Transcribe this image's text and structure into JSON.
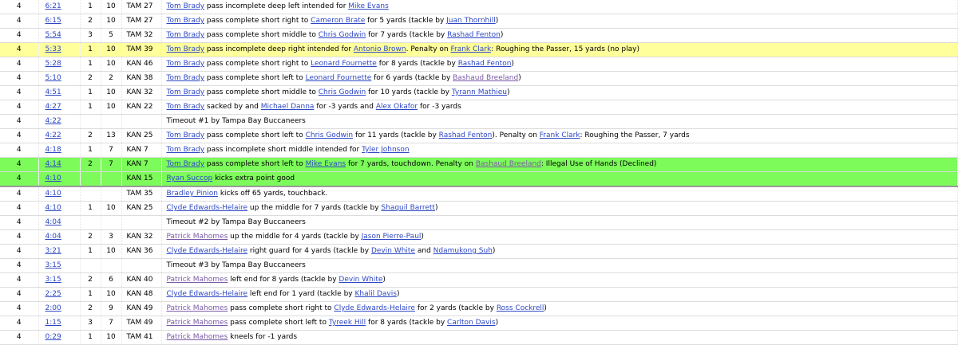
{
  "colors": {
    "link": "#2e48c5",
    "visited_link": "#7b5aa6",
    "highlight_penalty": "#ffff9b",
    "highlight_score": "#7cfb5a"
  },
  "rows": [
    {
      "quarter": "4",
      "time": "6:21",
      "down": "1",
      "togo": "10",
      "location": "TAM 27",
      "style": "plain",
      "detail": [
        {
          "t": "link",
          "v": "Tom Brady"
        },
        {
          "t": "text",
          "v": " pass incomplete deep left intended for "
        },
        {
          "t": "link",
          "v": "Mike Evans"
        }
      ]
    },
    {
      "quarter": "4",
      "time": "6:15",
      "down": "2",
      "togo": "10",
      "location": "TAM 27",
      "style": "plain",
      "detail": [
        {
          "t": "link",
          "v": "Tom Brady"
        },
        {
          "t": "text",
          "v": " pass complete short right to "
        },
        {
          "t": "link",
          "v": "Cameron Brate"
        },
        {
          "t": "text",
          "v": " for 5 yards (tackle by "
        },
        {
          "t": "link",
          "v": "Juan Thornhill"
        },
        {
          "t": "text",
          "v": ")"
        }
      ]
    },
    {
      "quarter": "4",
      "time": "5:54",
      "down": "3",
      "togo": "5",
      "location": "TAM 32",
      "style": "plain",
      "detail": [
        {
          "t": "link",
          "v": "Tom Brady"
        },
        {
          "t": "text",
          "v": " pass complete short middle to "
        },
        {
          "t": "link",
          "v": "Chris Godwin"
        },
        {
          "t": "text",
          "v": " for 7 yards (tackle by "
        },
        {
          "t": "link",
          "v": "Rashad Fenton"
        },
        {
          "t": "text",
          "v": ")"
        }
      ]
    },
    {
      "quarter": "4",
      "time": "5:33",
      "down": "1",
      "togo": "10",
      "location": "TAM 39",
      "style": "yellow",
      "detail": [
        {
          "t": "link",
          "v": "Tom Brady"
        },
        {
          "t": "text",
          "v": " pass incomplete deep right intended for "
        },
        {
          "t": "link",
          "v": "Antonio Brown"
        },
        {
          "t": "text",
          "v": ". Penalty on "
        },
        {
          "t": "link",
          "v": "Frank Clark"
        },
        {
          "t": "text",
          "v": ": Roughing the Passer, 15 yards (no play)"
        }
      ]
    },
    {
      "quarter": "4",
      "time": "5:28",
      "down": "1",
      "togo": "10",
      "location": "KAN 46",
      "style": "plain",
      "detail": [
        {
          "t": "link",
          "v": "Tom Brady"
        },
        {
          "t": "text",
          "v": " pass complete short right to "
        },
        {
          "t": "link",
          "v": "Leonard Fournette"
        },
        {
          "t": "text",
          "v": " for 8 yards (tackle by "
        },
        {
          "t": "link",
          "v": "Rashad Fenton"
        },
        {
          "t": "text",
          "v": ")"
        }
      ]
    },
    {
      "quarter": "4",
      "time": "5:10",
      "down": "2",
      "togo": "2",
      "location": "KAN 38",
      "style": "plain",
      "detail": [
        {
          "t": "link",
          "v": "Tom Brady"
        },
        {
          "t": "text",
          "v": " pass complete short left to "
        },
        {
          "t": "link",
          "v": "Leonard Fournette"
        },
        {
          "t": "text",
          "v": " for 6 yards (tackle by "
        },
        {
          "t": "vlink",
          "v": "Bashaud Breeland"
        },
        {
          "t": "text",
          "v": ")"
        }
      ]
    },
    {
      "quarter": "4",
      "time": "4:51",
      "down": "1",
      "togo": "10",
      "location": "KAN 32",
      "style": "plain",
      "detail": [
        {
          "t": "link",
          "v": "Tom Brady"
        },
        {
          "t": "text",
          "v": " pass complete short middle to "
        },
        {
          "t": "link",
          "v": "Chris Godwin"
        },
        {
          "t": "text",
          "v": " for 10 yards (tackle by "
        },
        {
          "t": "link",
          "v": "Tyrann Mathieu"
        },
        {
          "t": "text",
          "v": ")"
        }
      ]
    },
    {
      "quarter": "4",
      "time": "4:27",
      "down": "1",
      "togo": "10",
      "location": "KAN 22",
      "style": "plain",
      "detail": [
        {
          "t": "link",
          "v": "Tom Brady"
        },
        {
          "t": "text",
          "v": " sacked by and "
        },
        {
          "t": "link",
          "v": "Michael Danna"
        },
        {
          "t": "text",
          "v": " for -3 yards and "
        },
        {
          "t": "link",
          "v": "Alex Okafor"
        },
        {
          "t": "text",
          "v": " for -3 yards"
        }
      ]
    },
    {
      "quarter": "4",
      "time": "4:22",
      "down": "",
      "togo": "",
      "location": "",
      "style": "plain",
      "detail": [
        {
          "t": "text",
          "v": "Timeout #1 by Tampa Bay Buccaneers"
        }
      ]
    },
    {
      "quarter": "4",
      "time": "4:22",
      "down": "2",
      "togo": "13",
      "location": "KAN 25",
      "style": "plain",
      "detail": [
        {
          "t": "link",
          "v": "Tom Brady"
        },
        {
          "t": "text",
          "v": " pass complete short left to "
        },
        {
          "t": "link",
          "v": "Chris Godwin"
        },
        {
          "t": "text",
          "v": " for 11 yards (tackle by "
        },
        {
          "t": "link",
          "v": "Rashad Fenton"
        },
        {
          "t": "text",
          "v": "). Penalty on "
        },
        {
          "t": "link",
          "v": "Frank Clark"
        },
        {
          "t": "text",
          "v": ": Roughing the Passer, 7 yards"
        }
      ]
    },
    {
      "quarter": "4",
      "time": "4:18",
      "down": "1",
      "togo": "7",
      "location": "KAN 7",
      "style": "plain",
      "detail": [
        {
          "t": "link",
          "v": "Tom Brady"
        },
        {
          "t": "text",
          "v": " pass incomplete short middle intended for "
        },
        {
          "t": "link",
          "v": "Tyler Johnson"
        }
      ]
    },
    {
      "quarter": "4",
      "time": "4:14",
      "down": "2",
      "togo": "7",
      "location": "KAN 7",
      "style": "green",
      "detail": [
        {
          "t": "link",
          "v": "Tom Brady"
        },
        {
          "t": "text",
          "v": " pass complete short left to "
        },
        {
          "t": "link",
          "v": "Mike Evans"
        },
        {
          "t": "text",
          "v": " for 7 yards, touchdown. Penalty on "
        },
        {
          "t": "vlink",
          "v": "Bashaud Breeland"
        },
        {
          "t": "text",
          "v": ": Illegal Use of Hands (Declined)"
        }
      ]
    },
    {
      "quarter": "4",
      "time": "4:10",
      "down": "",
      "togo": "",
      "location": "KAN 15",
      "style": "green",
      "divider": true,
      "detail": [
        {
          "t": "link",
          "v": "Ryan Succop"
        },
        {
          "t": "text",
          "v": " kicks extra point good"
        }
      ]
    },
    {
      "quarter": "4",
      "time": "4:10",
      "down": "",
      "togo": "",
      "location": "TAM 35",
      "style": "plain",
      "detail": [
        {
          "t": "link",
          "v": "Bradley Pinion"
        },
        {
          "t": "text",
          "v": " kicks off 65 yards, touchback."
        }
      ]
    },
    {
      "quarter": "4",
      "time": "4:10",
      "down": "1",
      "togo": "10",
      "location": "KAN 25",
      "style": "plain",
      "detail": [
        {
          "t": "link",
          "v": "Clyde Edwards-Helaire"
        },
        {
          "t": "text",
          "v": " up the middle for 7 yards (tackle by "
        },
        {
          "t": "link",
          "v": "Shaquil Barrett"
        },
        {
          "t": "text",
          "v": ")"
        }
      ]
    },
    {
      "quarter": "4",
      "time": "4:04",
      "down": "",
      "togo": "",
      "location": "",
      "style": "plain",
      "detail": [
        {
          "t": "text",
          "v": "Timeout #2 by Tampa Bay Buccaneers"
        }
      ]
    },
    {
      "quarter": "4",
      "time": "4:04",
      "down": "2",
      "togo": "3",
      "location": "KAN 32",
      "style": "plain",
      "detail": [
        {
          "t": "vlink",
          "v": "Patrick Mahomes"
        },
        {
          "t": "text",
          "v": " up the middle for 4 yards (tackle by "
        },
        {
          "t": "link",
          "v": "Jason Pierre-Paul"
        },
        {
          "t": "text",
          "v": ")"
        }
      ]
    },
    {
      "quarter": "4",
      "time": "3:21",
      "down": "1",
      "togo": "10",
      "location": "KAN 36",
      "style": "plain",
      "detail": [
        {
          "t": "link",
          "v": "Clyde Edwards-Helaire"
        },
        {
          "t": "text",
          "v": " right guard for 4 yards (tackle by "
        },
        {
          "t": "link",
          "v": "Devin White"
        },
        {
          "t": "text",
          "v": " and "
        },
        {
          "t": "link",
          "v": "Ndamukong Suh"
        },
        {
          "t": "text",
          "v": ")"
        }
      ]
    },
    {
      "quarter": "4",
      "time": "3:15",
      "down": "",
      "togo": "",
      "location": "",
      "style": "plain",
      "detail": [
        {
          "t": "text",
          "v": "Timeout #3 by Tampa Bay Buccaneers"
        }
      ]
    },
    {
      "quarter": "4",
      "time": "3:15",
      "down": "2",
      "togo": "6",
      "location": "KAN 40",
      "style": "plain",
      "detail": [
        {
          "t": "vlink",
          "v": "Patrick Mahomes"
        },
        {
          "t": "text",
          "v": " left end for 8 yards (tackle by "
        },
        {
          "t": "link",
          "v": "Devin White"
        },
        {
          "t": "text",
          "v": ")"
        }
      ]
    },
    {
      "quarter": "4",
      "time": "2:25",
      "down": "1",
      "togo": "10",
      "location": "KAN 48",
      "style": "plain",
      "detail": [
        {
          "t": "link",
          "v": "Clyde Edwards-Helaire"
        },
        {
          "t": "text",
          "v": " left end for 1 yard (tackle by "
        },
        {
          "t": "link",
          "v": "Khalil Davis"
        },
        {
          "t": "text",
          "v": ")"
        }
      ]
    },
    {
      "quarter": "4",
      "time": "2:00",
      "down": "2",
      "togo": "9",
      "location": "KAN 49",
      "style": "plain",
      "detail": [
        {
          "t": "vlink",
          "v": "Patrick Mahomes"
        },
        {
          "t": "text",
          "v": " pass complete short right to "
        },
        {
          "t": "link",
          "v": "Clyde Edwards-Helaire"
        },
        {
          "t": "text",
          "v": " for 2 yards (tackle by "
        },
        {
          "t": "link",
          "v": "Ross Cockrell"
        },
        {
          "t": "text",
          "v": ")"
        }
      ]
    },
    {
      "quarter": "4",
      "time": "1:15",
      "down": "3",
      "togo": "7",
      "location": "TAM 49",
      "style": "plain",
      "detail": [
        {
          "t": "vlink",
          "v": "Patrick Mahomes"
        },
        {
          "t": "text",
          "v": " pass complete short left to "
        },
        {
          "t": "link",
          "v": "Tyreek Hill"
        },
        {
          "t": "text",
          "v": " for 8 yards (tackle by "
        },
        {
          "t": "link",
          "v": "Carlton Davis"
        },
        {
          "t": "text",
          "v": ")"
        }
      ]
    },
    {
      "quarter": "4",
      "time": "0:29",
      "down": "1",
      "togo": "10",
      "location": "TAM 41",
      "style": "plain",
      "detail": [
        {
          "t": "vlink",
          "v": "Patrick Mahomes"
        },
        {
          "t": "text",
          "v": " kneels for -1 yards"
        }
      ]
    }
  ]
}
